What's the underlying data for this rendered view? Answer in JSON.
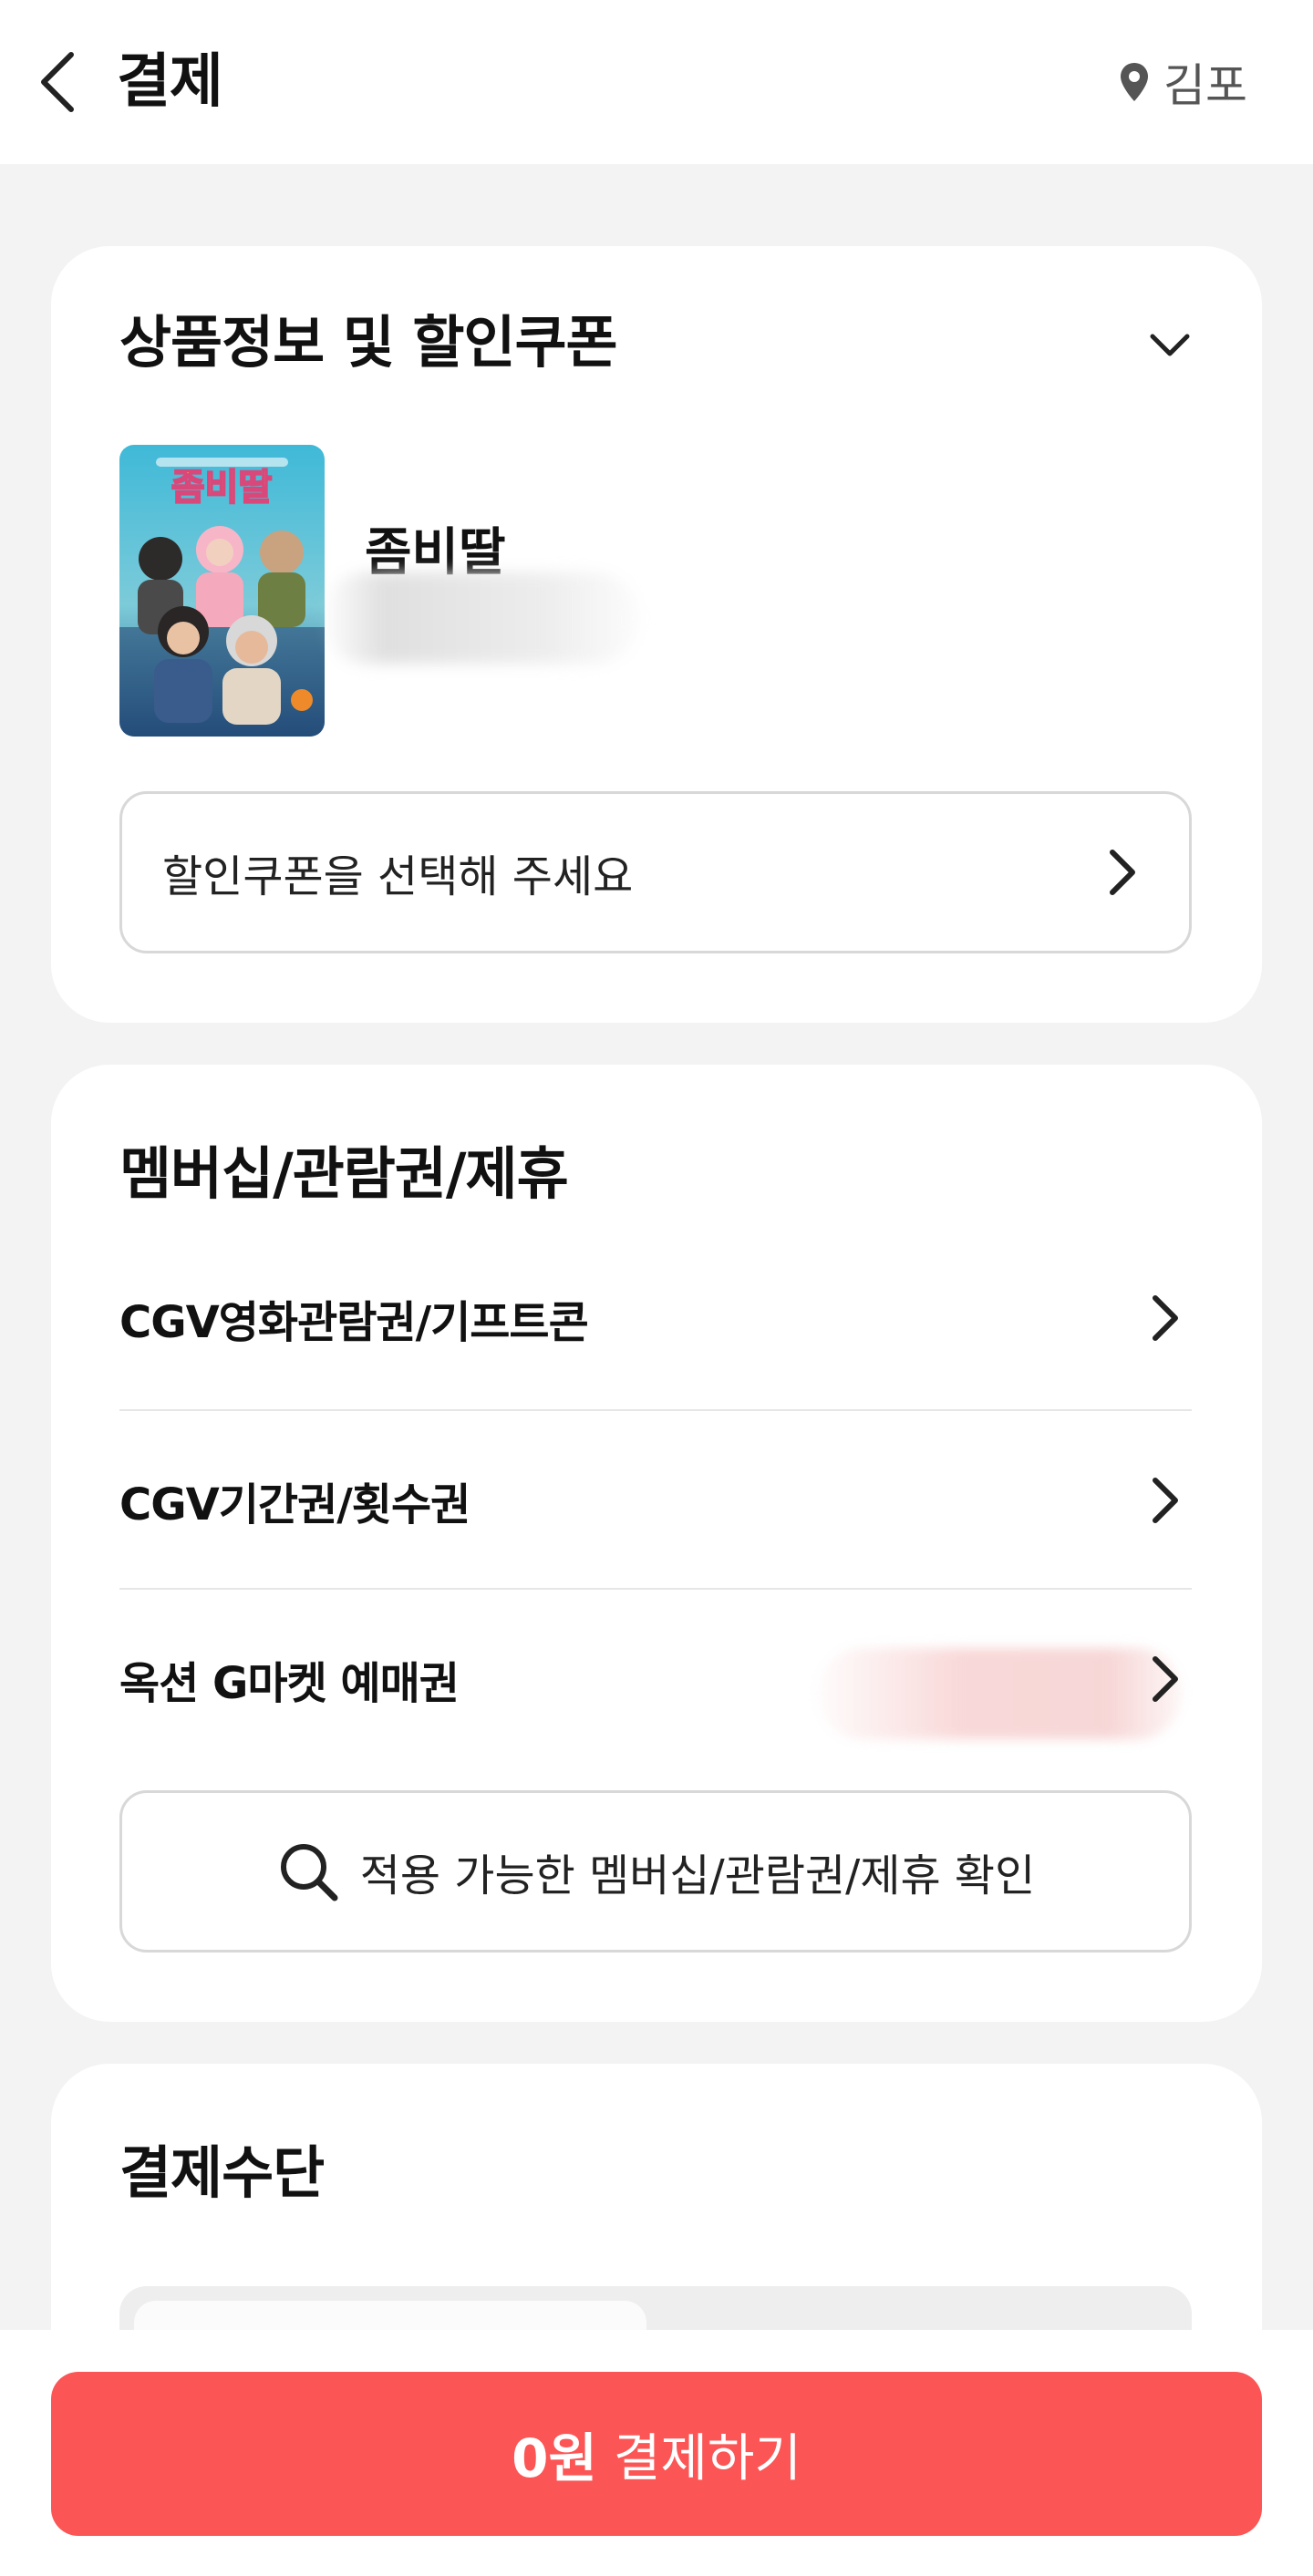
{
  "header": {
    "title": "결제",
    "location": "김포"
  },
  "product_section": {
    "title": "상품정보 및 할인쿠폰",
    "movie_title": "좀비딸",
    "poster_text": "좀비딸",
    "coupon_placeholder": "할인쿠폰을 선택해 주세요"
  },
  "membership_section": {
    "title": "멤버십/관람권/제휴",
    "items": [
      {
        "label": "CGV영화관람권/기프트콘"
      },
      {
        "label": "CGV기간권/횟수권"
      },
      {
        "label": "옥션 G마켓 예매권"
      }
    ],
    "search_label": "적용 가능한 멤버십/관람권/제휴 확인"
  },
  "payment_section": {
    "title": "결제수단"
  },
  "pay_button": {
    "amount": "0원",
    "label": "결제하기"
  },
  "colors": {
    "accent": "#fc5555",
    "background": "#f3f3f3"
  }
}
